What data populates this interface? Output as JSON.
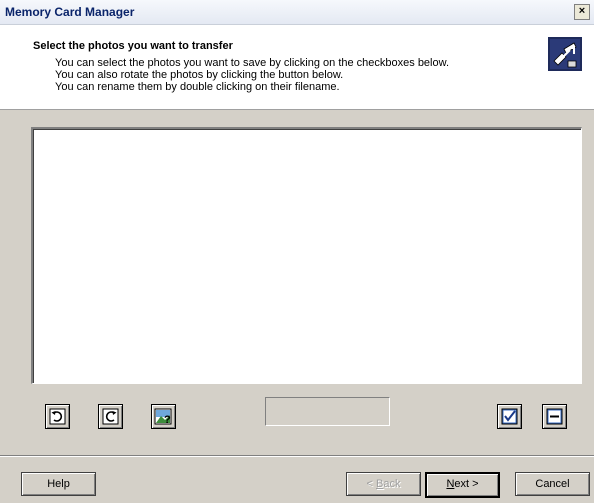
{
  "window": {
    "title": "Memory Card Manager",
    "close_symbol": "×"
  },
  "header": {
    "title": "Select the photos you want to transfer",
    "lines": [
      "You can select the photos you want to save by clicking on the checkboxes below.",
      "You can also rotate the photos by clicking the button below.",
      "You can rename them by double clicking on their filename."
    ],
    "icon": "transfer-wizard-icon"
  },
  "toolbar": {
    "rotate_left_icon": "rotate-left-icon",
    "rotate_right_icon": "rotate-right-icon",
    "preview_icon": "photo-help-icon",
    "select_all_icon": "checkbox-checked-icon",
    "deselect_all_icon": "checkbox-clear-icon",
    "status_text": ""
  },
  "footer": {
    "help_label": "Help",
    "back_mnemonic": "B",
    "back_rest": "ack",
    "back_prefix": "< ",
    "next_mnemonic": "N",
    "next_rest": "ext >",
    "cancel_label": "Cancel"
  },
  "colors": {
    "dialog_bg": "#d4d0c8",
    "title_text": "#0a246a",
    "list_bg": "#ffffff",
    "disabled_text": "#a0a0a0"
  }
}
